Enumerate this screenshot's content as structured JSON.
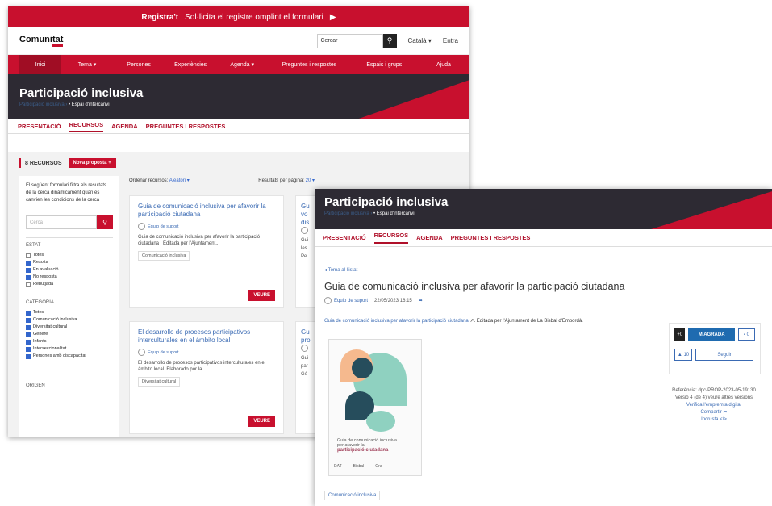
{
  "win1": {
    "regbar": {
      "label": "Registra't",
      "text": "Sol·licita el registre omplint el formulari",
      "arrow": "▶"
    },
    "header": {
      "logo": "Comunitat",
      "search_placeholder": "Cercar",
      "lang": "Català ▾",
      "entra": "Entra"
    },
    "nav": [
      "Inici",
      "Tema ▾",
      "Persones",
      "Experiències",
      "Agenda ▾",
      "Preguntes i respostes",
      "Espais i grups",
      "Ajuda"
    ],
    "banner": {
      "title": "Participació inclusiva",
      "bc_muted": "Participació inclusiva ›",
      "bc": "Espai d'intercanvi"
    },
    "tabs": [
      "PRESENTACIÓ",
      "RECURSOS",
      "AGENDA",
      "PREGUNTES I RESPOSTES"
    ],
    "recursos": {
      "count": "8 RECURSOS",
      "new": "Nova proposta +"
    },
    "filters": {
      "intro": "El següent formulari filtra els resultats de la cerca dinàmicament quan es canvien les condicions de la cerca",
      "search_placeholder": "Cerca",
      "estat_title": "ESTAT",
      "estat": [
        {
          "label": "Totes",
          "on": false
        },
        {
          "label": "Resolta",
          "on": true
        },
        {
          "label": "En avaluació",
          "on": true
        },
        {
          "label": "No resposta",
          "on": true
        },
        {
          "label": "Rebutjada",
          "on": false
        }
      ],
      "cat_title": "CATEGORIA",
      "cat": [
        {
          "label": "Totes",
          "on": true
        },
        {
          "label": "Comunicació inclusiva",
          "on": true
        },
        {
          "label": "Diversitat cultural",
          "on": true
        },
        {
          "label": "Gènere",
          "on": true
        },
        {
          "label": "Infants",
          "on": true
        },
        {
          "label": "Interseccionalitat",
          "on": true
        },
        {
          "label": "Persones amb discapacitat",
          "on": true
        }
      ],
      "origen_title": "ORIGEN"
    },
    "sort": {
      "label": "Ordenar recursos:",
      "value": "Aleatori ▾",
      "per_page_label": "Resultats per pàgina:",
      "per_page": "20 ▾"
    },
    "cards": [
      {
        "title": "Guia de comunicació inclusiva per afavorir la participació ciutadana",
        "author": "Equip de suport",
        "desc": "Guia de comunicació inclusiva per afavorir la participació ciutadana . Editada per l'Ajuntament...",
        "tag": "Comunicació inclusiva",
        "btn": "VEURE"
      },
      {
        "title": "El desarrollo de procesos participativos interculturales en el ámbito local",
        "author": "Equip de suport",
        "desc": "El desarrollo de procesos participativos interculturales en el ámbito local. Elaborado por la...",
        "tag": "Diversitat cultural",
        "btn": "VEURE"
      }
    ],
    "partial_cards": [
      {
        "l1": "Gu",
        "l2": "vo",
        "l3": "dis",
        "d1": "Gui",
        "d2": "les",
        "d3": "Pe"
      },
      {
        "l1": "Gu",
        "l2": "pro",
        "d1": "Gui",
        "d2": "par",
        "d3": "Gé"
      }
    ]
  },
  "win2": {
    "banner": {
      "title": "Participació inclusiva",
      "bc_muted": "Participació inclusiva ›",
      "bc": "Espai d'intercanvi"
    },
    "tabs": [
      "PRESENTACIÓ",
      "RECURSOS",
      "AGENDA",
      "PREGUNTES I RESPOSTES"
    ],
    "back": "◂ Torna al llistat",
    "title": "Guia de comunicació inclusiva per afavorir la participació ciutadana",
    "author": "Equip de suport",
    "date": "22/05/2023 16:15",
    "desc_link": "Guia de comunicació inclusiva per afavorir la participació ciutadana",
    "desc_rest": ". Editada per l'Ajuntament de La Bisbal d'Empordà.",
    "cover_text": "Guia de comunicació inclusiva per afavorir la",
    "cover_bold": "participació ciutadana",
    "cover_foot": [
      "DAT",
      "Bisbal",
      "Gra"
    ],
    "tag": "Comunicació inclusiva",
    "actions": {
      "count": "+0",
      "like": "M'AGRADA",
      "comments": "▪ 0",
      "follow_count": "▲ 10",
      "follow": "Seguir"
    },
    "ref": {
      "reference": "Referència: dpc-PROP-2023-05-19130",
      "version": "Versió 4 (de 4) veure altres versions",
      "verify": "Verifica l'empremta digital",
      "share": "Compartir ➦",
      "embed": "Incrusta </>"
    }
  }
}
